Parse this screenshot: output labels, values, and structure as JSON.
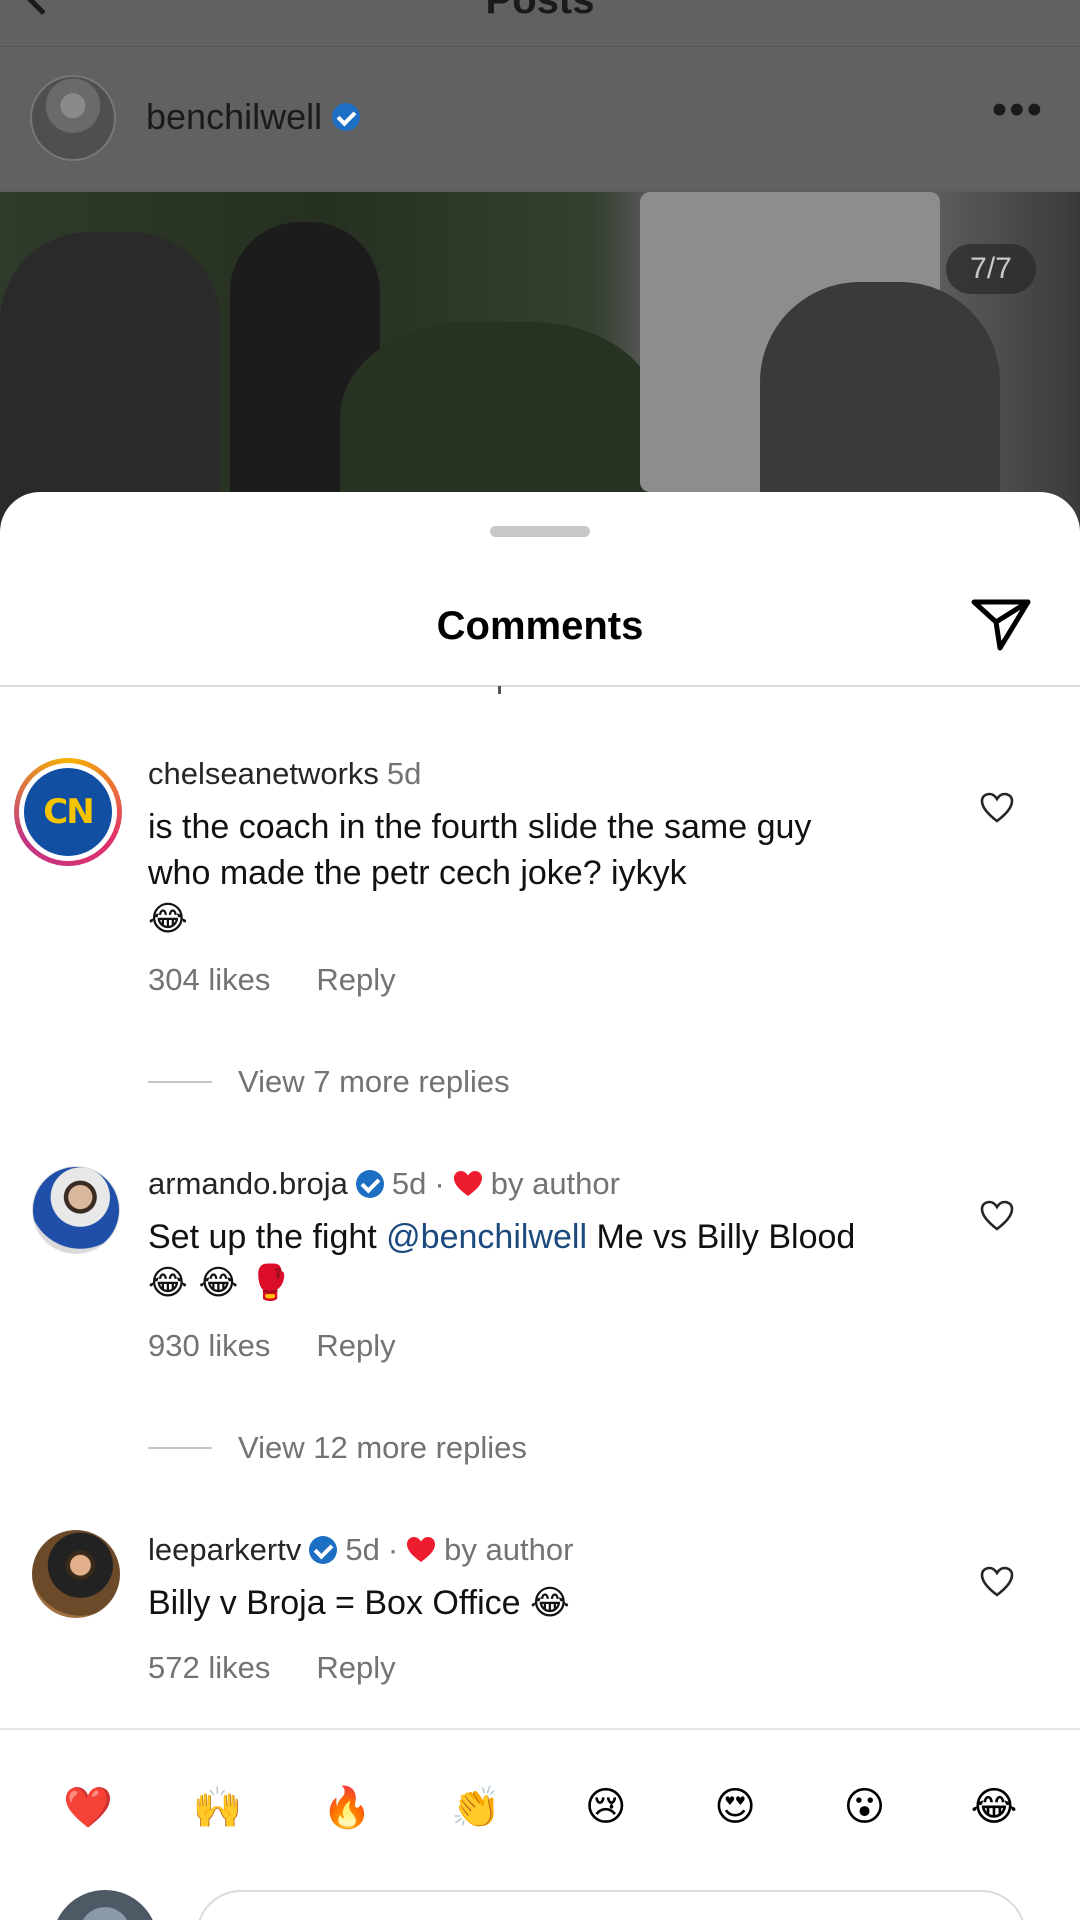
{
  "header": {
    "title": "Posts"
  },
  "post": {
    "username": "benchilwell",
    "slide_indicator": "7/7"
  },
  "sheet": {
    "title": "Comments"
  },
  "comments": [
    {
      "username": "chelseanetworks",
      "time": "5d",
      "text": "is the coach in the fourth slide the same guy who made the petr cech joke? iykyk",
      "emoji": "😂",
      "likes": "304 likes",
      "reply": "Reply",
      "view_replies": "View 7 more replies"
    },
    {
      "username": "armando.broja",
      "time": "5d",
      "dot": "·",
      "by_author": "by author",
      "text_before": "Set up the fight ",
      "mention": "@benchilwell",
      "text_after": " Me vs Billy Blood",
      "emoji": "😂 😂 🥊",
      "likes": "930 likes",
      "reply": "Reply",
      "view_replies": "View 12 more replies"
    },
    {
      "username": "leeparkertv",
      "time": "5d",
      "dot": "·",
      "by_author": "by author",
      "text": "Billy v Broja = Box Office ",
      "emoji": "😂",
      "likes": "572 likes",
      "reply": "Reply"
    }
  ],
  "reactions": [
    "❤️",
    "🙌",
    "🔥",
    "👏",
    "😢",
    "😍",
    "😮",
    "😂"
  ],
  "colors": {
    "accent_blue": "#1d6fc4",
    "heart_red": "#ed1c2e",
    "muted": "#737373"
  }
}
